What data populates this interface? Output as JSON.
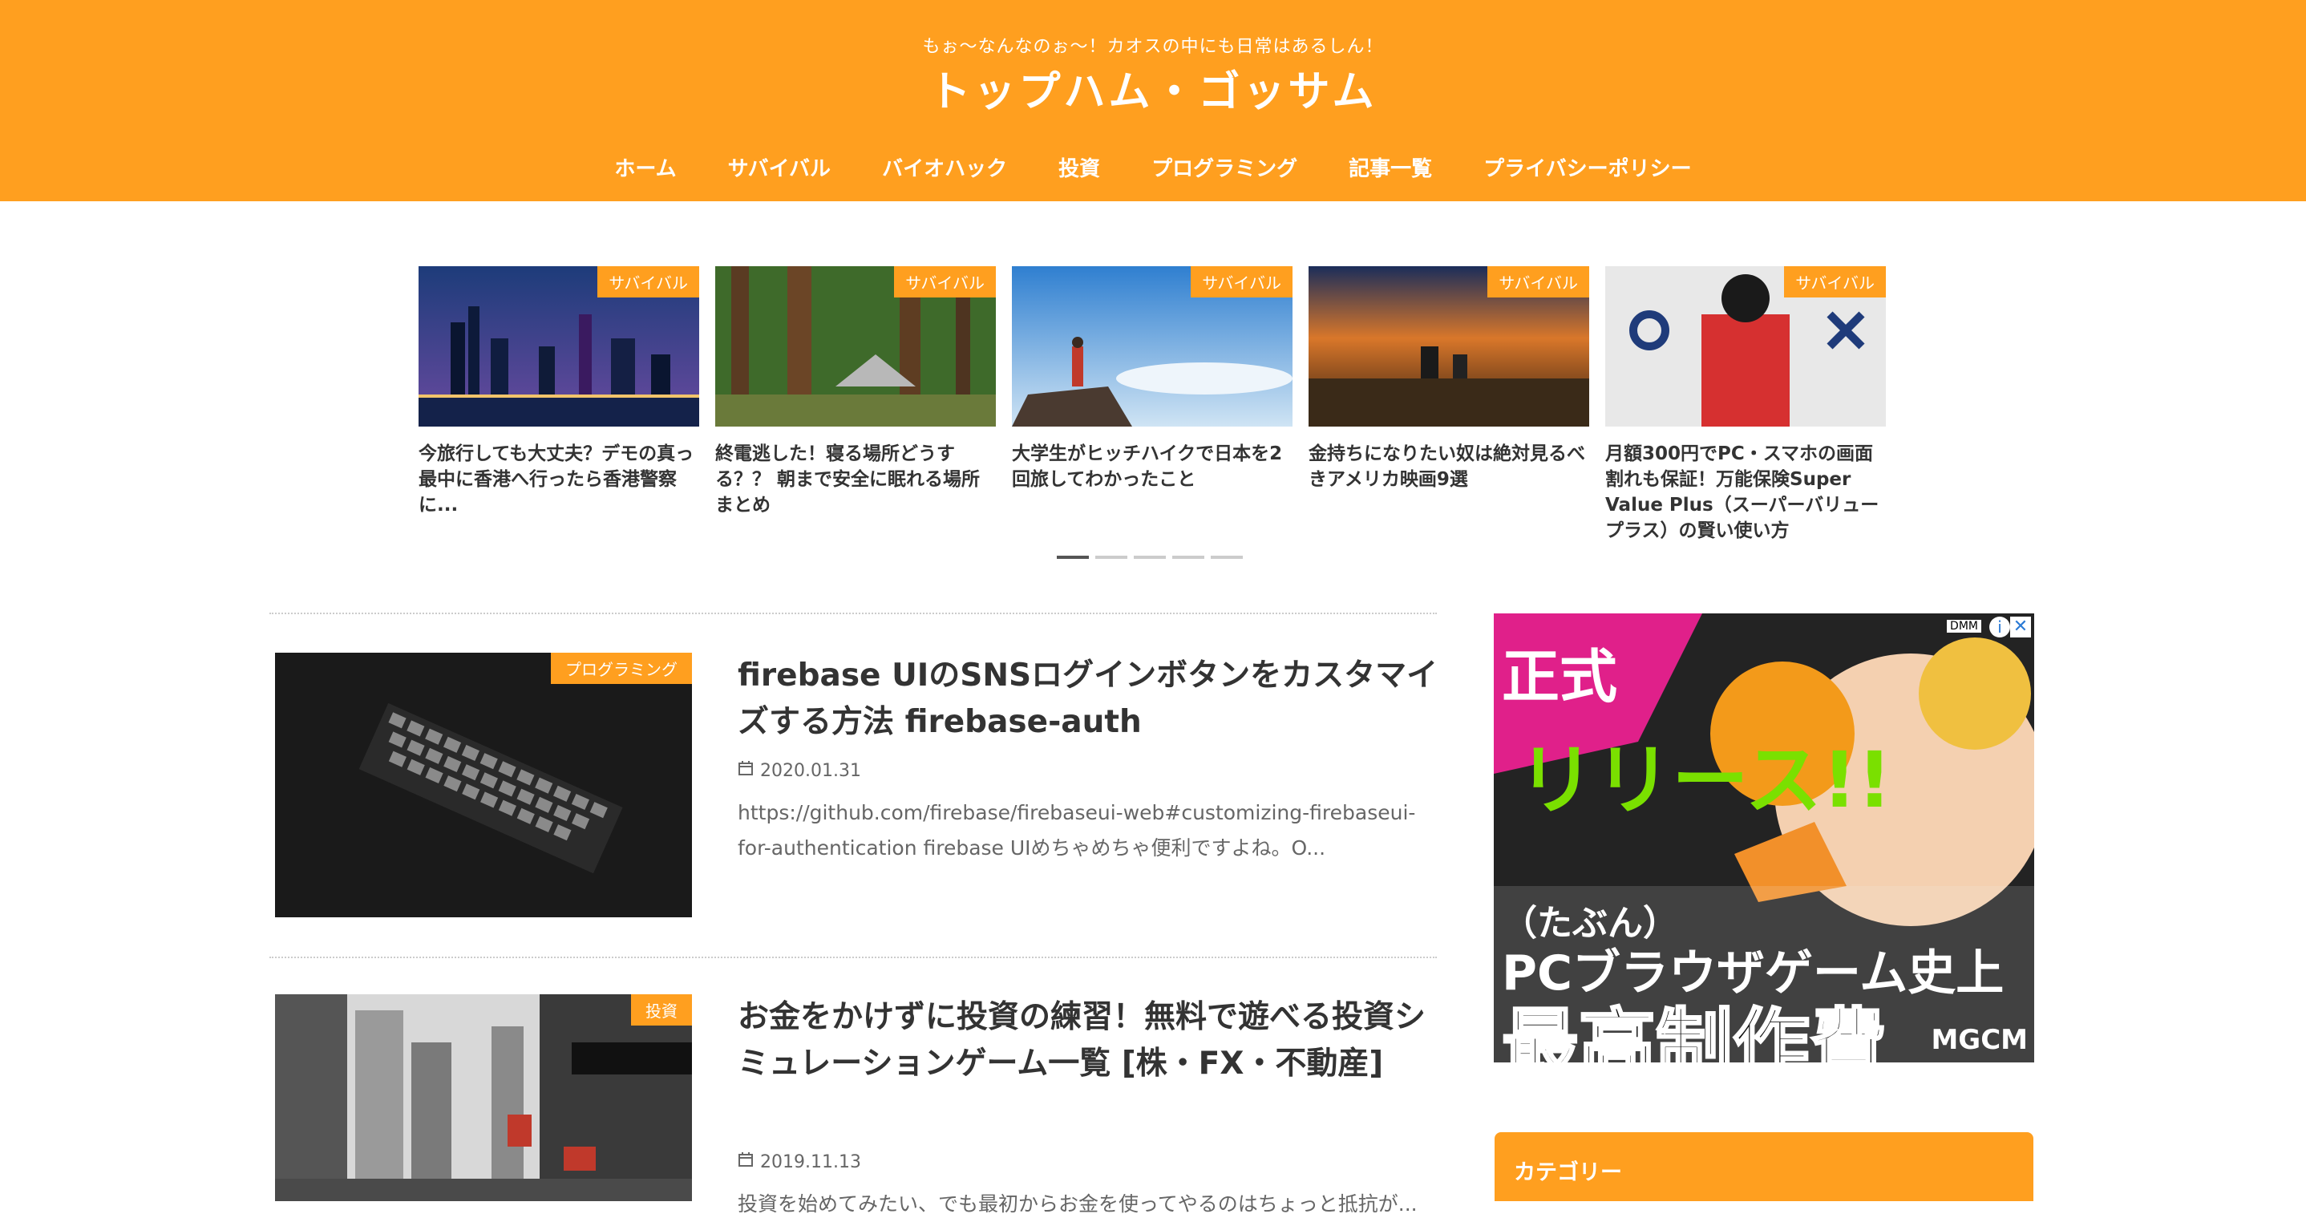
{
  "header": {
    "tagline": "もぉ〜なんなのぉ〜！カオスの中にも日常はあるしん！",
    "site_title": "トップハム・ゴッサム",
    "nav": [
      "ホーム",
      "サバイバル",
      "バイオハック",
      "投資",
      "プログラミング",
      "記事一覧",
      "プライバシーポリシー"
    ]
  },
  "carousel": [
    {
      "category": "サバイバル",
      "title": "今旅行しても大丈夫？デモの真っ最中に香港へ行ったら香港警察に..."
    },
    {
      "category": "サバイバル",
      "title": "終電逃した！寝る場所どうする？？ 朝まで安全に眠れる場所まとめ"
    },
    {
      "category": "サバイバル",
      "title": "大学生がヒッチハイクで日本を2回旅してわかったこと"
    },
    {
      "category": "サバイバル",
      "title": "金持ちになりたい奴は絶対見るべきアメリカ映画9選"
    },
    {
      "category": "サバイバル",
      "title": "月額300円でPC・スマホの画面割れも保証！万能保険Super Value Plus（スーパーバリュープラス）の賢い使い方"
    }
  ],
  "carousel_dots": {
    "count": 5,
    "active": 1
  },
  "articles": [
    {
      "category": "プログラミング",
      "title": "firebase UIのSNSログインボタンをカスタマイズする方法 firebase-auth",
      "date": "2020.01.31",
      "excerpt": "https://github.com/firebase/firebaseui-web#customizing-firebaseui-for-authentication firebase UIめちゃめちゃ便利ですよね。O..."
    },
    {
      "category": "投資",
      "title": "お金をかけずに投資の練習！無料で遊べる投資シミュレーションゲーム一覧 [株・FX・不動産]",
      "date": "2019.11.13",
      "excerpt": "投資を始めてみたい、でも最初からお金を使ってやるのはちょっと抵抗が..."
    }
  ],
  "ad": {
    "line1": "正式",
    "line2": "リリース!!",
    "line3": "（たぶん）",
    "line4": "PCブラウザゲーム史上",
    "line5": "最高制作費",
    "logo": "MGCM",
    "dmm": "DMM",
    "info": "i",
    "close": "✕"
  },
  "sidebar": {
    "category_title": "カテゴリー"
  }
}
